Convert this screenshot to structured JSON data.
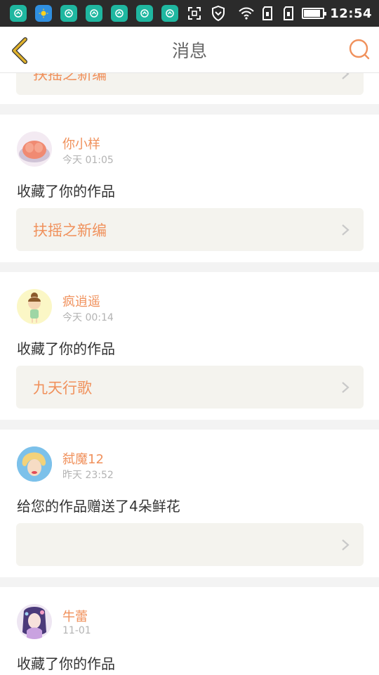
{
  "status_bar": {
    "time": "12:54",
    "app_icons": [
      "app-icon",
      "weather-icon",
      "app-icon",
      "app-icon",
      "app-icon",
      "app-icon",
      "app-icon"
    ],
    "battery_level": 0.9
  },
  "header": {
    "title": "消息",
    "back_icon": "chevron-left-icon",
    "search_icon": "search-icon"
  },
  "messages": [
    {
      "work_title": "扶摇之新编"
    },
    {
      "user": "你小样",
      "time": "今天 01:05",
      "action": "收藏了你的作品",
      "work_title": "扶摇之新编"
    },
    {
      "user": "疯逍遥",
      "time": "今天 00:14",
      "action": "收藏了你的作品",
      "work_title": "九天行歌"
    },
    {
      "user": "弑魔12",
      "time": "昨天 23:52",
      "action": "给您的作品赠送了4朵鲜花",
      "work_title": ""
    },
    {
      "user": "牛蕾",
      "time": "11-01",
      "action": "收藏了你的作品"
    }
  ],
  "colors": {
    "accent": "#f0915c",
    "back_arrow": "#e0b22c",
    "card_link_bg": "#f4f3ee",
    "page_bg": "#f3f3f3",
    "status_bar_bg": "#2b2b2b"
  }
}
